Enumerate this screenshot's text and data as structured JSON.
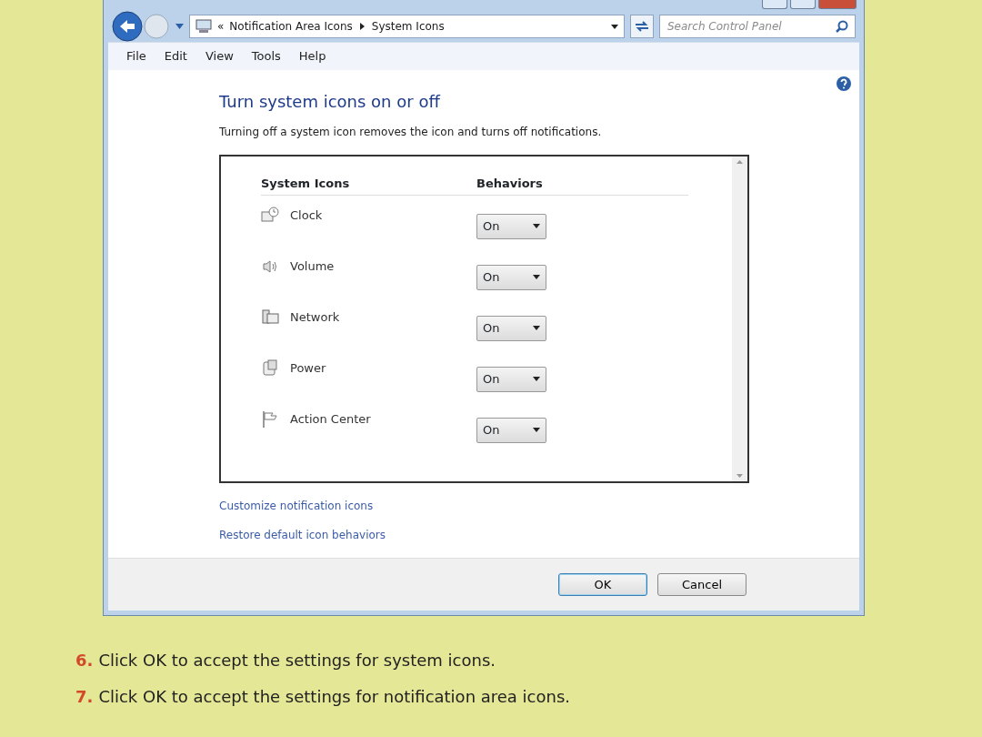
{
  "address_bar": {
    "overflow_marker": "«",
    "breadcrumb": [
      "Notification Area Icons",
      "System Icons"
    ]
  },
  "search": {
    "placeholder": "Search Control Panel"
  },
  "menu": [
    "File",
    "Edit",
    "View",
    "Tools",
    "Help"
  ],
  "heading": "Turn system icons on or off",
  "description": "Turning off a system icon removes the icon and turns off notifications.",
  "table": {
    "columns": [
      "System Icons",
      "Behaviors"
    ],
    "rows": [
      {
        "kind": "clock",
        "name": "Clock",
        "behavior": "On"
      },
      {
        "kind": "volume",
        "name": "Volume",
        "behavior": "On"
      },
      {
        "kind": "network",
        "name": "Network",
        "behavior": "On"
      },
      {
        "kind": "power",
        "name": "Power",
        "behavior": "On"
      },
      {
        "kind": "flag",
        "name": "Action Center",
        "behavior": "On"
      }
    ]
  },
  "links": [
    "Customize notification icons",
    "Restore default icon behaviors"
  ],
  "buttons": [
    {
      "label": "OK",
      "default": true
    },
    {
      "label": "Cancel",
      "default": false
    }
  ],
  "steps": [
    {
      "number": "6.",
      "text": "Click OK to accept the settings for system icons."
    },
    {
      "number": "7.",
      "text": "Click OK to accept the settings for notification area icons."
    }
  ]
}
